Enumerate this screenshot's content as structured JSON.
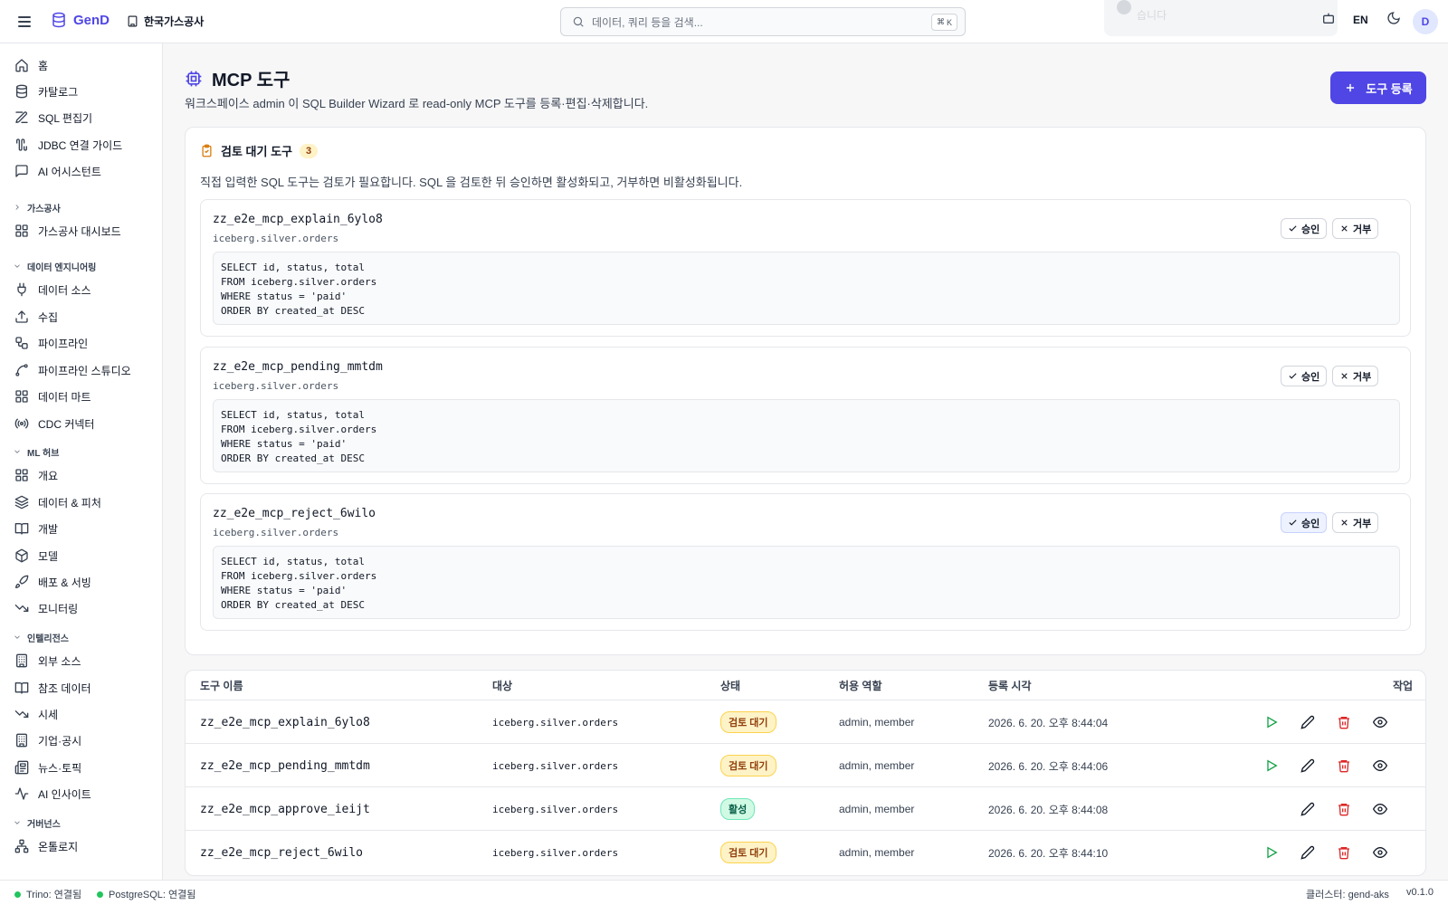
{
  "header": {
    "app_name": "GenD",
    "org_name": "한국가스공사",
    "search_placeholder": "데이터, 쿼리 등을 검색...",
    "search_shortcut_1": "⌘",
    "search_shortcut_2": "K",
    "toast_text": "습니다",
    "language": "EN",
    "avatar_initial": "D",
    "accent_color": "#4f46e5"
  },
  "sidebar": {
    "items_top": [
      {
        "label": "홈",
        "icon": "home-icon"
      },
      {
        "label": "카탈로그",
        "icon": "database-icon"
      },
      {
        "label": "SQL 편집기",
        "icon": "edit-icon"
      },
      {
        "label": "JDBC 연결 가이드",
        "icon": "cable-icon"
      },
      {
        "label": "AI 어시스턴트",
        "icon": "chat-icon"
      }
    ],
    "section_gas": "가스공사",
    "gas_items": [
      {
        "label": "가스공사 대시보드",
        "icon": "dashboard-icon"
      }
    ],
    "section_de": "데이터 엔지니어링",
    "de_items": [
      {
        "label": "데이터 소스",
        "icon": "plug-icon"
      },
      {
        "label": "수집",
        "icon": "upload-icon"
      },
      {
        "label": "파이프라인",
        "icon": "workflow-icon"
      },
      {
        "label": "파이프라인 스튜디오",
        "icon": "spline-icon"
      },
      {
        "label": "데이터 마트",
        "icon": "grid-icon"
      },
      {
        "label": "CDC 커넥터",
        "icon": "radio-icon"
      }
    ],
    "section_ml": "ML 허브",
    "ml_items": [
      {
        "label": "개요",
        "icon": "grid-icon"
      },
      {
        "label": "데이터 & 피처",
        "icon": "layers-icon"
      },
      {
        "label": "개발",
        "icon": "book-icon"
      },
      {
        "label": "모델",
        "icon": "box-icon"
      },
      {
        "label": "배포 & 서빙",
        "icon": "rocket-icon"
      },
      {
        "label": "모니터링",
        "icon": "trend-down-icon"
      }
    ],
    "section_intel": "인텔리전스",
    "intel_items": [
      {
        "label": "외부 소스",
        "icon": "building-icon"
      },
      {
        "label": "참조 데이터",
        "icon": "book-icon"
      },
      {
        "label": "시세",
        "icon": "trend-down-icon"
      },
      {
        "label": "기업·공시",
        "icon": "building-icon"
      },
      {
        "label": "뉴스·토픽",
        "icon": "newspaper-icon"
      },
      {
        "label": "AI 인사이트",
        "icon": "activity-icon"
      }
    ],
    "section_gov": "거버넌스",
    "gov_items": [
      {
        "label": "온톨로지",
        "icon": "network-icon"
      }
    ]
  },
  "page": {
    "title": "MCP 도구",
    "description": "워크스페이스 admin 이 SQL Builder Wizard 로 read-only MCP 도구를 등록·편집·삭제합니다.",
    "register_button": "도구 등록"
  },
  "pending": {
    "title": "검토 대기 도구",
    "count": "3",
    "description": "직접 입력한 SQL 도구는 검토가 필요합니다. SQL 을 검토한 뒤 승인하면 활성화되고, 거부하면 비활성화됩니다.",
    "approve_label": "승인",
    "reject_label": "거부",
    "tools": [
      {
        "name": "zz_e2e_mcp_explain_6ylo8",
        "target": "iceberg.silver.orders",
        "sql": "SELECT id, status, total\nFROM iceberg.silver.orders\nWHERE status = 'paid'\nORDER BY created_at DESC"
      },
      {
        "name": "zz_e2e_mcp_pending_mmtdm",
        "target": "iceberg.silver.orders",
        "sql": "SELECT id, status, total\nFROM iceberg.silver.orders\nWHERE status = 'paid'\nORDER BY created_at DESC"
      },
      {
        "name": "zz_e2e_mcp_reject_6wilo",
        "target": "iceberg.silver.orders",
        "sql": "SELECT id, status, total\nFROM iceberg.silver.orders\nWHERE status = 'paid'\nORDER BY created_at DESC"
      }
    ]
  },
  "table": {
    "headers": {
      "name": "도구 이름",
      "target": "대상",
      "status": "상태",
      "roles": "허용 역할",
      "registered": "등록 시각",
      "actions": "작업"
    },
    "rows": [
      {
        "name": "zz_e2e_mcp_explain_6ylo8",
        "target": "iceberg.silver.orders",
        "status": "검토 대기",
        "roles": "admin, member",
        "registered": "2026. 6. 20. 오후 8:44:04"
      },
      {
        "name": "zz_e2e_mcp_pending_mmtdm",
        "target": "iceberg.silver.orders",
        "status": "검토 대기",
        "roles": "admin, member",
        "registered": "2026. 6. 20. 오후 8:44:06"
      },
      {
        "name": "zz_e2e_mcp_approve_ieijt",
        "target": "iceberg.silver.orders",
        "status": "활성",
        "roles": "admin, member",
        "registered": "2026. 6. 20. 오후 8:44:08"
      },
      {
        "name": "zz_e2e_mcp_reject_6wilo",
        "target": "iceberg.silver.orders",
        "status": "검토 대기",
        "roles": "admin, member",
        "registered": "2026. 6. 20. 오후 8:44:10"
      }
    ]
  },
  "statusbar": {
    "trino": "Trino: 연결됨",
    "postgres": "PostgreSQL: 연결됨",
    "cluster": "클러스터: gend-aks",
    "version": "v0.1.0"
  }
}
